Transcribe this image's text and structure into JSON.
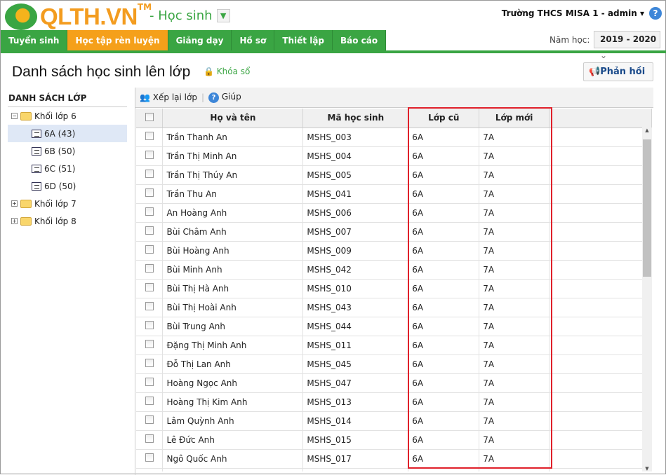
{
  "header": {
    "logo": "QLTH.VN",
    "tm": "TM",
    "module": "- Học sinh",
    "user": "Trường THCS MISA 1 - admin",
    "year_label": "Năm học:",
    "year": "2019 - 2020"
  },
  "nav": [
    "Tuyển sinh",
    "Học tập rèn luyện",
    "Giảng dạy",
    "Hồ sơ",
    "Thiết lập",
    "Báo cáo"
  ],
  "page": {
    "title": "Danh sách học sinh lên lớp",
    "lock": "Khóa sổ",
    "feedback": "Phản hồi"
  },
  "sidebar": {
    "title": "DANH SÁCH LỚP",
    "groups": [
      "Khối lớp 6",
      "Khối lớp 7",
      "Khối lớp 8"
    ],
    "classes": [
      "6A (43)",
      "6B (50)",
      "6C (51)",
      "6D (50)"
    ]
  },
  "toolbar": {
    "rearrange": "Xếp lại lớp",
    "help": "Giúp"
  },
  "table": {
    "headers": [
      "Họ và tên",
      "Mã học sinh",
      "Lớp cũ",
      "Lớp mới"
    ],
    "rows": [
      [
        "Trần Thanh An",
        "MSHS_003",
        "6A",
        "7A"
      ],
      [
        "Trần Thị Minh An",
        "MSHS_004",
        "6A",
        "7A"
      ],
      [
        "Trần Thị Thúy An",
        "MSHS_005",
        "6A",
        "7A"
      ],
      [
        "Trần Thu An",
        "MSHS_041",
        "6A",
        "7A"
      ],
      [
        "An Hoàng Anh",
        "MSHS_006",
        "6A",
        "7A"
      ],
      [
        "Bùi Châm Anh",
        "MSHS_007",
        "6A",
        "7A"
      ],
      [
        "Bùi Hoàng Anh",
        "MSHS_009",
        "6A",
        "7A"
      ],
      [
        "Bùi Minh Anh",
        "MSHS_042",
        "6A",
        "7A"
      ],
      [
        "Bùi Thị Hà Anh",
        "MSHS_010",
        "6A",
        "7A"
      ],
      [
        "Bùi Thị Hoài Anh",
        "MSHS_043",
        "6A",
        "7A"
      ],
      [
        "Bùi Trung Anh",
        "MSHS_044",
        "6A",
        "7A"
      ],
      [
        "Đặng Thị Minh Anh",
        "MSHS_011",
        "6A",
        "7A"
      ],
      [
        "Đỗ Thị Lan Anh",
        "MSHS_045",
        "6A",
        "7A"
      ],
      [
        "Hoàng Ngọc Anh",
        "MSHS_047",
        "6A",
        "7A"
      ],
      [
        "Hoàng Thị Kim Anh",
        "MSHS_013",
        "6A",
        "7A"
      ],
      [
        "Lâm Quỳnh Anh",
        "MSHS_014",
        "6A",
        "7A"
      ],
      [
        "Lê Đức Anh",
        "MSHS_015",
        "6A",
        "7A"
      ],
      [
        "Ngô Quốc Anh",
        "MSHS_017",
        "6A",
        "7A"
      ]
    ]
  }
}
